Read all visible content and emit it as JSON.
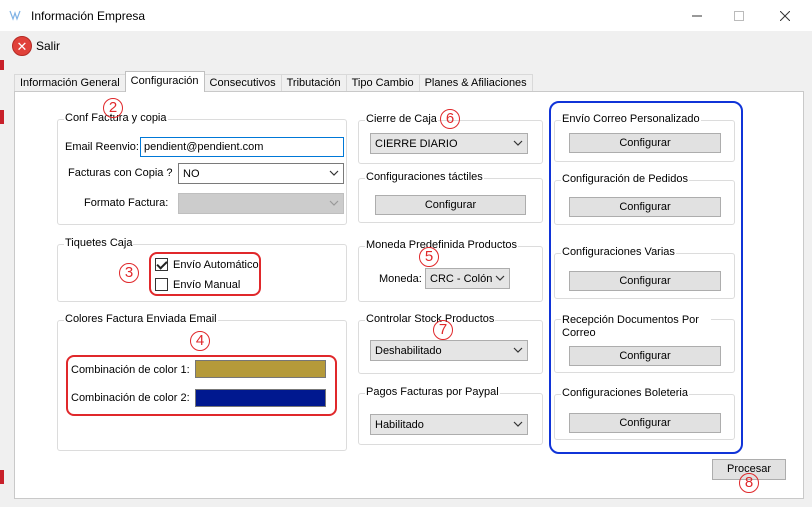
{
  "window": {
    "title": "Información Empresa",
    "icon": "app-icon"
  },
  "toolbar": {
    "salir_label": "Salir",
    "salir_icon": "close-circle-icon"
  },
  "tabs": [
    {
      "label": "Información General"
    },
    {
      "label": "Configuración"
    },
    {
      "label": "Consecutivos"
    },
    {
      "label": "Tributación"
    },
    {
      "label": "Tipo Cambio"
    },
    {
      "label": "Planes & Afiliaciones"
    }
  ],
  "conf_factura": {
    "title": "Conf Factura y copia",
    "email_label": "Email Reenvio:",
    "email_value": "pendient@pendient.com",
    "copias_label": "Facturas con Copia ?",
    "copias_value": "NO",
    "formato_label": "Formato Factura:",
    "formato_value": ""
  },
  "tiquetes": {
    "title": "Tiquetes Caja",
    "envio_auto": {
      "label": "Envío Automático",
      "checked": true
    },
    "envio_manual": {
      "label": "Envío Manual",
      "checked": false
    }
  },
  "colores": {
    "title": "Colores Factura Enviada Email",
    "color1_label": "Combinación de color 1:",
    "color1": "#B59A3A",
    "color2_label": "Combinación de color 2:",
    "color2": "#00188F"
  },
  "cierre_caja": {
    "title": "Cierre de Caja",
    "value": "CIERRE DIARIO"
  },
  "tactiles": {
    "title": "Configuraciones táctiles",
    "button": "Configurar"
  },
  "moneda": {
    "title": "Moneda Predefinida Productos",
    "label": "Moneda:",
    "value": "CRC - Colón"
  },
  "stock": {
    "title": "Controlar Stock Productos",
    "value": "Deshabilitado"
  },
  "paypal": {
    "title": "Pagos Facturas por Paypal",
    "value": "Habilitado"
  },
  "right_groups": [
    {
      "title": "Envío Correo Personalizado",
      "button": "Configurar"
    },
    {
      "title": "Configuración de Pedidos",
      "button": "Configurar"
    },
    {
      "title": "Configuraciones Varias",
      "button": "Configurar"
    },
    {
      "title": "Recepción Documentos Por Correo",
      "button": "Configurar"
    },
    {
      "title": "Configuraciones Boleteria",
      "button": "Configurar"
    }
  ],
  "procesar_label": "Procesar",
  "markers": [
    "2",
    "3",
    "4",
    "5",
    "6",
    "7",
    "8"
  ],
  "colors": {
    "accent_red": "#E0282B",
    "accent_blue": "#1034D8",
    "focus_blue": "#0078D7"
  }
}
